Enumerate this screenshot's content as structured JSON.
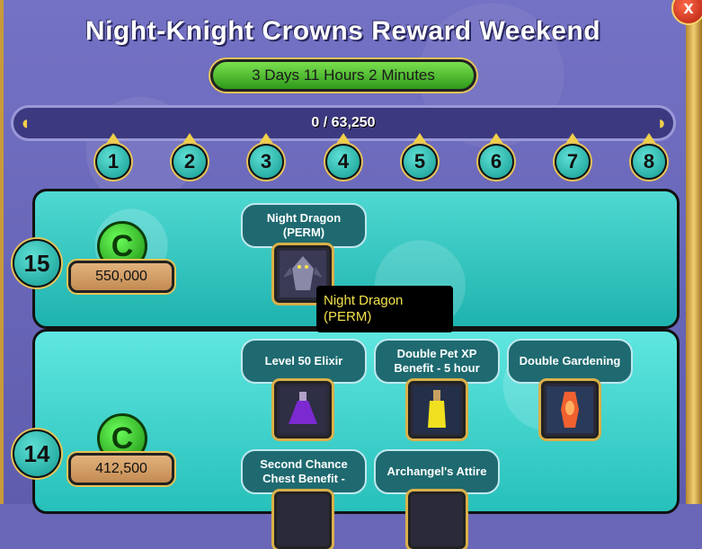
{
  "window": {
    "title": "Night-Knight Crowns Reward Weekend",
    "close_label": "x"
  },
  "timer": {
    "text": "3 Days 11 Hours 2 Minutes"
  },
  "progress": {
    "text": "0 / 63,250",
    "current": 0,
    "max": 63250
  },
  "milestones": [
    "1",
    "2",
    "3",
    "4",
    "5",
    "6",
    "7",
    "8"
  ],
  "tiers": [
    {
      "level": "15",
      "cost": "550,000",
      "items": [
        {
          "label": "Night Dragon (PERM)",
          "icon": "dragon-icon"
        }
      ]
    },
    {
      "level": "14",
      "cost": "412,500",
      "items": [
        {
          "label": "Level 50 Elixir",
          "icon": "purple-potion-icon"
        },
        {
          "label": "Double Pet XP Benefit - 5 hour",
          "icon": "yellow-potion-icon"
        },
        {
          "label": "Double Gardening",
          "icon": "lava-lamp-icon"
        },
        {
          "label": "Second Chance Chest Benefit -",
          "icon": "chest-icon"
        },
        {
          "label": "Archangel's Attire",
          "icon": "attire-icon"
        }
      ]
    }
  ],
  "tooltip": {
    "text": "Night Dragon (PERM)"
  },
  "colors": {
    "accent": "#e8c456",
    "teal": "#1fb3ae",
    "timer_green": "#2e9a1a"
  }
}
